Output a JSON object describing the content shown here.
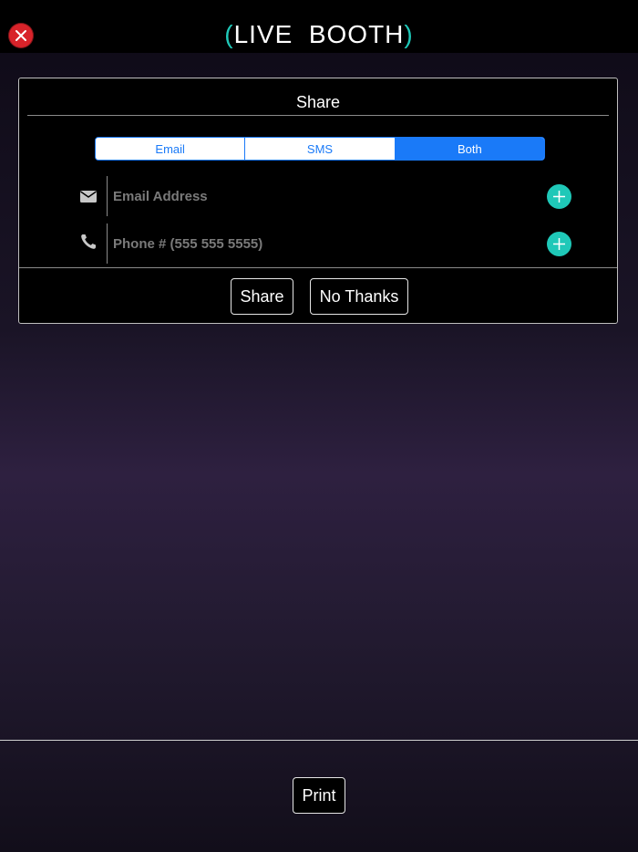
{
  "header": {
    "title_open": "(",
    "title_text": "LIVE  BOOTH",
    "title_close": ")",
    "close_icon": "close-icon",
    "accent_color": "#1fc8b8"
  },
  "share_dialog": {
    "title": "Share",
    "tabs": [
      {
        "label": "Email",
        "selected": false
      },
      {
        "label": "SMS",
        "selected": false
      },
      {
        "label": "Both",
        "selected": true
      }
    ],
    "email_field": {
      "placeholder": "Email Address",
      "value": "",
      "icon": "envelope-icon"
    },
    "phone_field": {
      "placeholder": "Phone # (555 555 5555)",
      "value": "",
      "icon": "phone-icon"
    },
    "add_icon": "plus-icon",
    "share_label": "Share",
    "no_thanks_label": "No Thanks",
    "tab_color": "#1a7af8"
  },
  "footer": {
    "print_label": "Print"
  }
}
